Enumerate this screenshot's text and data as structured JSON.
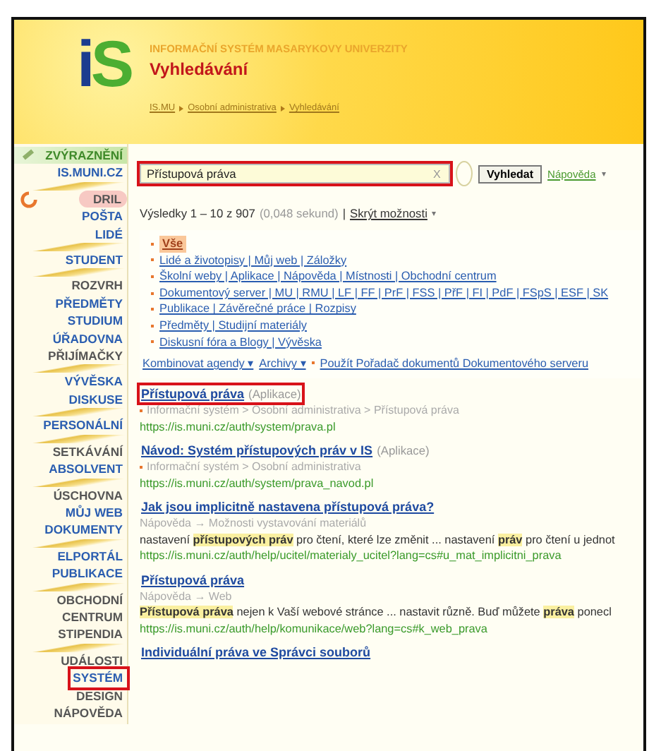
{
  "header": {
    "logo": "iS",
    "org": "INFORMAČNÍ SYSTÉM MASARYKOVY UNIVERZITY",
    "title": "Vyhledávání",
    "breadcrumb": [
      "IS.MU",
      "Osobní administrativa",
      "Vyhledávání"
    ]
  },
  "sidebar": {
    "groups": [
      [
        {
          "label": "ZVÝRAZNĚNÍ",
          "kind": "pen",
          "color": "#3f8a2a",
          "highlighted": false
        },
        {
          "label": "IS.MUNI.CZ",
          "kind": "plain",
          "color": "#2a5db0",
          "highlighted": false
        }
      ],
      [
        {
          "label": "DRIL",
          "kind": "dril",
          "color": "#555555",
          "highlighted": false
        },
        {
          "label": "POŠTA",
          "kind": "plain",
          "color": "#2a5db0",
          "highlighted": false
        },
        {
          "label": "LIDÉ",
          "kind": "plain",
          "color": "#2a5db0",
          "highlighted": false
        }
      ],
      [
        {
          "label": "STUDENT",
          "kind": "plain",
          "color": "#2a5db0",
          "highlighted": false
        }
      ],
      [
        {
          "label": "ROZVRH",
          "kind": "plain",
          "color": "#555555",
          "highlighted": false
        },
        {
          "label": "PŘEDMĚTY",
          "kind": "plain",
          "color": "#2a5db0",
          "highlighted": false
        },
        {
          "label": "STUDIUM",
          "kind": "plain",
          "color": "#2a5db0",
          "highlighted": false
        },
        {
          "label": "ÚŘADOVNA",
          "kind": "plain",
          "color": "#2a5db0",
          "highlighted": false
        },
        {
          "label": "PŘIJÍMAČKY",
          "kind": "plain",
          "color": "#555555",
          "highlighted": false
        }
      ],
      [
        {
          "label": "VÝVĚSKA",
          "kind": "plain",
          "color": "#2a5db0",
          "highlighted": false
        },
        {
          "label": "DISKUSE",
          "kind": "plain",
          "color": "#2a5db0",
          "highlighted": false
        }
      ],
      [
        {
          "label": "PERSONÁLNÍ",
          "kind": "plain",
          "color": "#2a5db0",
          "highlighted": false
        }
      ],
      [
        {
          "label": "SETKÁVÁNÍ",
          "kind": "plain",
          "color": "#555555",
          "highlighted": false
        },
        {
          "label": "ABSOLVENT",
          "kind": "plain",
          "color": "#2a5db0",
          "highlighted": false
        }
      ],
      [
        {
          "label": "ÚSCHOVNA",
          "kind": "plain",
          "color": "#555555",
          "highlighted": false
        },
        {
          "label": "MŮJ WEB",
          "kind": "plain",
          "color": "#2a5db0",
          "highlighted": false
        },
        {
          "label": "DOKUMENTY",
          "kind": "plain",
          "color": "#2a5db0",
          "highlighted": false
        }
      ],
      [
        {
          "label": "ELPORTÁL",
          "kind": "plain",
          "color": "#2a5db0",
          "highlighted": false
        },
        {
          "label": "PUBLIKACE",
          "kind": "plain",
          "color": "#2a5db0",
          "highlighted": false
        }
      ],
      [
        {
          "label": "OBCHODNÍ CENTRUM",
          "kind": "plain",
          "color": "#555555",
          "highlighted": false
        },
        {
          "label": "STIPENDIA",
          "kind": "plain",
          "color": "#555555",
          "highlighted": false
        }
      ],
      [
        {
          "label": "UDÁLOSTI",
          "kind": "plain",
          "color": "#555555",
          "highlighted": false
        },
        {
          "label": "SYSTÉM",
          "kind": "plain",
          "color": "#2a5db0",
          "highlighted": true
        },
        {
          "label": "DESIGN",
          "kind": "plain",
          "color": "#555555",
          "highlighted": false
        },
        {
          "label": "NÁPOVĚDA",
          "kind": "plain",
          "color": "#555555",
          "highlighted": false
        }
      ]
    ]
  },
  "search": {
    "value": "Přístupová práva",
    "highlighted": true,
    "clear": "X",
    "button": "Vyhledat",
    "help": "Nápověda",
    "help_caret": "▾"
  },
  "summary": {
    "count": "Výsledky 1 – 10 z 907",
    "time": "(0,048 sekund)",
    "separator": "|",
    "toggle": "Skrýt možnosti",
    "toggle_caret": "▾"
  },
  "filters": [
    {
      "text": "Vše",
      "selected": true
    },
    {
      "text": "Lidé a životopisy | Můj web | Záložky",
      "selected": false
    },
    {
      "text": "Školní weby | Aplikace | Nápověda | Místnosti | Obchodní centrum",
      "selected": false
    },
    {
      "text": "Dokumentový server | MU | RMU | LF | FF | PrF | FSS | PřF | FI | PdF | FSpS | ESF | SK",
      "selected": false
    },
    {
      "text": "Publikace | Závěrečné práce | Rozpisy",
      "selected": false
    },
    {
      "text": "Předměty | Studijní materiály",
      "selected": false
    },
    {
      "text": "Diskusní fóra a Blogy | Vývěska",
      "selected": false
    }
  ],
  "options": [
    "Kombinovat agendy ▾",
    "Archivy ▾",
    "Použít Pořadač dokumentů Dokumentového serveru"
  ],
  "results": [
    {
      "title": "Přístupová práva",
      "tag": "(Aplikace)",
      "highlighted": true,
      "path": "Informační systém > Osobní administrativa > Přístupová práva",
      "bullet": true,
      "url": "https://is.muni.cz/auth/system/prava.pl"
    },
    {
      "title": "Návod: Systém přístupových práv v IS",
      "tag": "(Aplikace)",
      "highlighted": false,
      "path": "Informační systém > Osobní administrativa",
      "bullet": true,
      "url": "https://is.muni.cz/auth/system/prava_navod.pl"
    },
    {
      "title": "Jak jsou implicitně nastavena přístupová práva?",
      "highlighted": false,
      "path": "Nápověda → Možnosti vystavování materiálů",
      "bullet": false,
      "snippet": "nastavení **přístupových práv** pro čtení, které lze změnit ... nastavení **práv** pro čtení u jednot",
      "url": "https://is.muni.cz/auth/help/ucitel/materialy_ucitel?lang=cs#u_mat_implicitni_prava"
    },
    {
      "title": "Přístupová práva",
      "highlighted": false,
      "path": "Nápověda → Web",
      "bullet": false,
      "snippet": "**Přístupová práva** nejen k Vaší webové stránce ... nastavit různě. Buď můžete **práva** ponecl",
      "url": "https://is.muni.cz/auth/help/komunikace/web?lang=cs#k_web_prava"
    },
    {
      "title": "Individuální práva ve Správci souborů",
      "highlighted": false
    }
  ]
}
